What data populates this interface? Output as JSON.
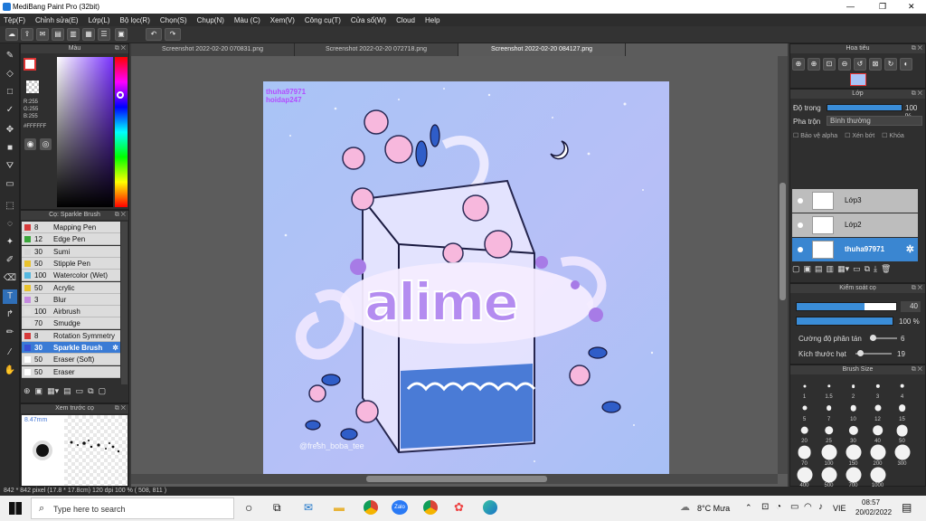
{
  "window": {
    "title": "MediBang Paint Pro (32bit)"
  },
  "menu": [
    "Tệp(F)",
    "Chỉnh sửa(E)",
    "Lớp(L)",
    "Bộ lọc(R)",
    "Chọn(S)",
    "Chụp(N)",
    "Màu (C)",
    "Xem(V)",
    "Công cụ(T)",
    "Cửa sổ(W)",
    "Cloud",
    "Help"
  ],
  "color_panel": {
    "title": "Màu",
    "r": "R:255",
    "g": "G:255",
    "b": "B:255",
    "hex": "#FFFFFF"
  },
  "brush_panel": {
    "title": "Cọ: Sparkle Brush",
    "items": [
      {
        "size": "8",
        "name": "Mapping Pen",
        "color": "#d73a3a"
      },
      {
        "size": "12",
        "name": "Edge Pen",
        "color": "#3aa63a"
      },
      {
        "size": "30",
        "name": "Sumi",
        "color": "#d5d5d5"
      },
      {
        "size": "50",
        "name": "Stipple Pen",
        "color": "#e8c22e"
      },
      {
        "size": "100",
        "name": "Watercolor (Wet)",
        "color": "#55b8e0"
      },
      {
        "size": "50",
        "name": "Acrylic",
        "color": "#e8c22e"
      },
      {
        "size": "3",
        "name": "Blur",
        "color": "#c58adf"
      },
      {
        "size": "100",
        "name": "Airbrush",
        "color": "#e0e0e0"
      },
      {
        "size": "70",
        "name": "Smudge",
        "color": "#e0e0e0"
      },
      {
        "size": "8",
        "name": "Rotation Symmetry",
        "color": "#d73a3a"
      },
      {
        "size": "30",
        "name": "Sparkle Brush",
        "color": "#3a50d5",
        "selected": true
      },
      {
        "size": "50",
        "name": "Eraser (Soft)",
        "color": "#ffffff"
      },
      {
        "size": "50",
        "name": "Eraser",
        "color": "#ffffff"
      }
    ]
  },
  "preview_panel": {
    "title": "Xem trước cọ",
    "size": "8.47mm"
  },
  "tabs": [
    "Screenshot 2022-02-20 070831.png",
    "Screenshot 2022-02-20 072718.png",
    "Screenshot 2022-02-20 084127.png"
  ],
  "artwork": {
    "title_text": "alime",
    "watermark_top": "thuha97971",
    "watermark_top2": "hoidap247",
    "signature": "@fresh_boba_tee"
  },
  "navigator": {
    "title": "Hoa tiêu"
  },
  "layer_panel": {
    "title": "Lớp",
    "opacity_label": "Độ trong",
    "opacity_value": "100 %",
    "opacity_pct": 100,
    "blend_label": "Pha trộn",
    "blend_value": "Bình thường",
    "protect_alpha": "Bảo vệ alpha",
    "clipping": "Xén bớt",
    "lock": "Khóa",
    "layers": [
      {
        "name": "Lớp3"
      },
      {
        "name": "Lớp2"
      },
      {
        "name": "thuha97971",
        "selected": true
      }
    ]
  },
  "brush_control": {
    "title": "Kiểm soát cọ",
    "size_value": "40",
    "size_pct": 40,
    "opacity_value": "100 %",
    "opacity_pct": 100,
    "scatter_label": "Cường độ phân tán",
    "scatter_value": "6",
    "spray_label": "Kích thước hạt",
    "spray_value": "19"
  },
  "brush_size_panel": {
    "title": "Brush Size",
    "sizes": [
      "1",
      "1.5",
      "2",
      "3",
      "4",
      "5",
      "7",
      "10",
      "12",
      "15",
      "20",
      "25",
      "30",
      "40",
      "50",
      "70",
      "100",
      "150",
      "200",
      "300",
      "400",
      "500",
      "700",
      "1000"
    ]
  },
  "statusbar": "842 * 842 pixel   (17.8 * 17.8cm)   120 dpi   100 %   ( 508, 811 )",
  "taskbar": {
    "search_placeholder": "Type here to search",
    "weather": "8°C  Mưa",
    "lang": "VIE",
    "time": "08:57",
    "date": "20/02/2022"
  }
}
